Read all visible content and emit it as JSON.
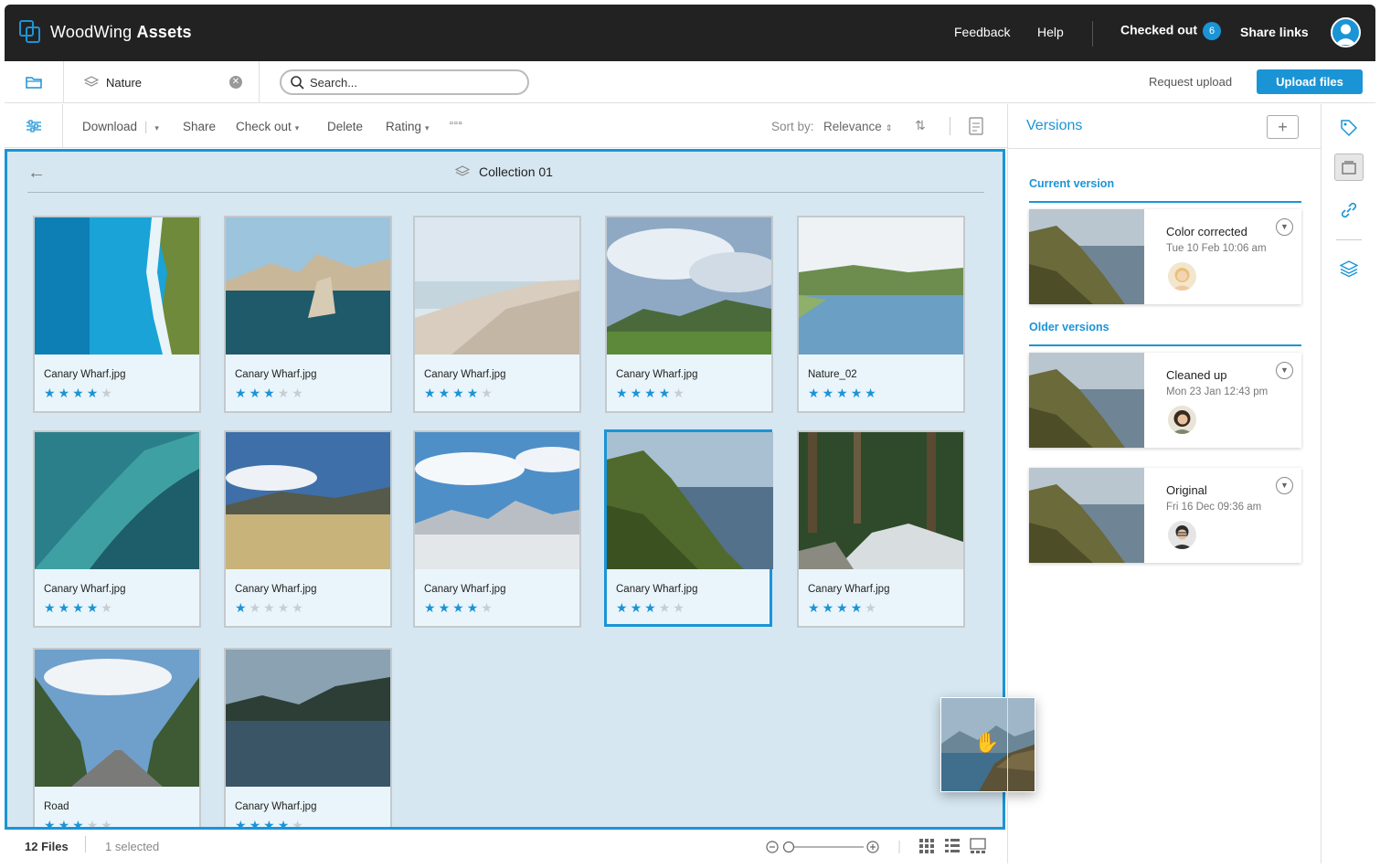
{
  "app": {
    "brand_prefix": "WoodWing",
    "brand_suffix": "Assets",
    "nav": {
      "feedback": "Feedback",
      "help": "Help",
      "checked_out": "Checked out",
      "checked_out_count": "6",
      "share_links": "Share links"
    }
  },
  "bar2": {
    "tab_label": "Nature",
    "search_placeholder": "Search...",
    "request_upload": "Request upload",
    "upload_files": "Upload files"
  },
  "toolbar": {
    "download": "Download",
    "share": "Share",
    "check_out": "Check out",
    "delete": "Delete",
    "rating": "Rating",
    "sort_label": "Sort by:",
    "sort_value": "Relevance"
  },
  "collection": {
    "title": "Collection 01",
    "assets": [
      {
        "name": "Canary Wharf.jpg",
        "rating": 4,
        "scene": "ocean-aerial"
      },
      {
        "name": "Canary Wharf.jpg",
        "rating": 3,
        "scene": "coast-rocks"
      },
      {
        "name": "Canary Wharf.jpg",
        "rating": 4,
        "scene": "beach"
      },
      {
        "name": "Canary Wharf.jpg",
        "rating": 4,
        "scene": "cloudy-valley"
      },
      {
        "name": "Nature_02",
        "rating": 5,
        "scene": "lake-hills"
      },
      {
        "name": "Canary Wharf.jpg",
        "rating": 4,
        "scene": "wave"
      },
      {
        "name": "Canary Wharf.jpg",
        "rating": 1,
        "scene": "grassland"
      },
      {
        "name": "Canary Wharf.jpg",
        "rating": 4,
        "scene": "snow-mountains"
      },
      {
        "name": "Canary Wharf.jpg",
        "rating": 3,
        "scene": "cliff-coast",
        "selected": true
      },
      {
        "name": "Canary Wharf.jpg",
        "rating": 4,
        "scene": "forest-stream"
      },
      {
        "name": "Road",
        "rating": 3,
        "scene": "road-mountains"
      },
      {
        "name": "Canary Wharf.jpg",
        "rating": 4,
        "scene": "misty-lake"
      }
    ]
  },
  "status": {
    "files": "12 Files",
    "selected": "1 selected"
  },
  "versions": {
    "title": "Versions",
    "current_label": "Current version",
    "older_label": "Older versions",
    "current": {
      "name": "Color corrected",
      "date": "Tue 10 Feb 10:06 am",
      "avatar": "blonde-woman"
    },
    "older": [
      {
        "name": "Cleaned up",
        "date": "Mon 23 Jan 12:43 pm",
        "avatar": "dark-hair-woman"
      },
      {
        "name": "Original",
        "date": "Fri 16 Dec 09:36 am",
        "avatar": "man-glasses"
      }
    ]
  },
  "colors": {
    "accent": "#1b94d6",
    "topbar": "#222222",
    "grid_bg": "#d6e7f1",
    "card_bg": "#eaf5fb"
  }
}
